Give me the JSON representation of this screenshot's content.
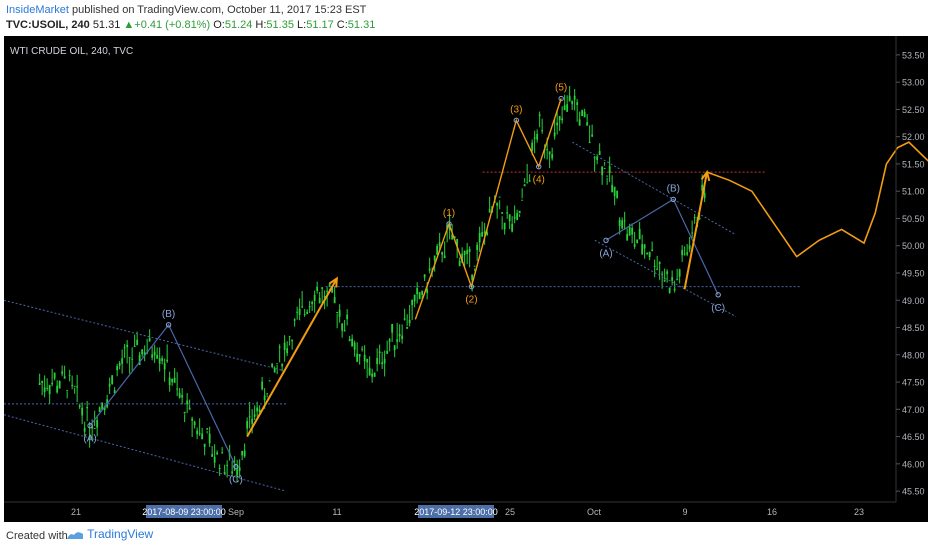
{
  "header": {
    "author": "InsideMarket",
    "published": "published on TradingView.com, October 11, 2017 15:23 EST",
    "symbol": "TVC:USOIL, 240",
    "last": "51.31",
    "change": "+0.41 (+0.81%)",
    "ohlc": {
      "o_label": "O:",
      "o": "51.24",
      "h_label": "H:",
      "h": "51.35",
      "l_label": "L:",
      "l": "51.17",
      "c_label": "C:",
      "c": "51.31"
    }
  },
  "footer": {
    "created_with": "Created with",
    "brand": "TradingView"
  },
  "colors": {
    "background": "#000000",
    "candle_up": "#27d33a",
    "wave_orange": "#f39c12",
    "channel_blue": "#4a67a8",
    "label_blue": "#8aa6d8",
    "axis_text": "#b2b5be",
    "highlight_label_bg": "#4c6fa8",
    "level_line": "#c0392b"
  },
  "chart_data": {
    "type": "line",
    "title": "WTI CRUDE OIL, 240, TVC",
    "xlabel": "",
    "ylabel": "",
    "ylim": [
      45.3,
      53.7
    ],
    "grid": false,
    "x_tick_labels": [
      "21",
      "Sep",
      "11",
      "25",
      "Oct",
      "9",
      "16",
      "23"
    ],
    "x_highlight_labels": [
      "2017-08-09 23:00:00",
      "2017-09-12 23:00:00"
    ],
    "y_tick_labels": [
      "53.50",
      "53.00",
      "52.50",
      "52.00",
      "51.50",
      "51.00",
      "50.50",
      "50.00",
      "49.50",
      "49.00",
      "48.50",
      "48.00",
      "47.50",
      "47.00",
      "46.50",
      "46.00",
      "45.50"
    ],
    "price_series_approx": {
      "name": "TVC:USOIL",
      "x": [
        "2017-08-15",
        "2017-08-17",
        "2017-08-20",
        "2017-08-23",
        "2017-08-25",
        "2017-08-28",
        "2017-08-30",
        "2017-08-31",
        "2017-09-04",
        "2017-09-06",
        "2017-09-08",
        "2017-09-11",
        "2017-09-13",
        "2017-09-15",
        "2017-09-18",
        "2017-09-20",
        "2017-09-22",
        "2017-09-24",
        "2017-09-26",
        "2017-09-27",
        "2017-09-29",
        "2017-10-02",
        "2017-10-04",
        "2017-10-06",
        "2017-10-08",
        "2017-10-10",
        "2017-10-11"
      ],
      "values": [
        47.5,
        46.7,
        47.9,
        48.2,
        47.2,
        46.2,
        45.9,
        46.6,
        48.4,
        49.2,
        48.9,
        47.6,
        48.3,
        48.9,
        50.2,
        49.6,
        50.7,
        50.3,
        52.2,
        51.8,
        52.7,
        51.4,
        50.2,
        49.9,
        49.2,
        50.4,
        51.31
      ]
    },
    "wave_labels": [
      {
        "label": "(A)",
        "x": "2017-08-17",
        "y": 46.7
      },
      {
        "label": "(B)",
        "x": "2017-08-24",
        "y": 48.55
      },
      {
        "label": "(C)",
        "x": "2017-08-30",
        "y": 45.95
      },
      {
        "label": "(1)",
        "x": "2017-09-18",
        "y": 50.4
      },
      {
        "label": "(2)",
        "x": "2017-09-20",
        "y": 49.25
      },
      {
        "label": "(3)",
        "x": "2017-09-24",
        "y": 52.3
      },
      {
        "label": "(4)",
        "x": "2017-09-26",
        "y": 51.45
      },
      {
        "label": "(5)",
        "x": "2017-09-28",
        "y": 52.7
      },
      {
        "label": "(A)",
        "x": "2017-10-02",
        "y": 50.1
      },
      {
        "label": "(B)",
        "x": "2017-10-08",
        "y": 50.85
      },
      {
        "label": "(C)",
        "x": "2017-10-12",
        "y": 49.1
      }
    ],
    "levels": [
      {
        "name": "resistance",
        "y": 51.35
      },
      {
        "name": "support",
        "y": 49.25
      }
    ]
  }
}
